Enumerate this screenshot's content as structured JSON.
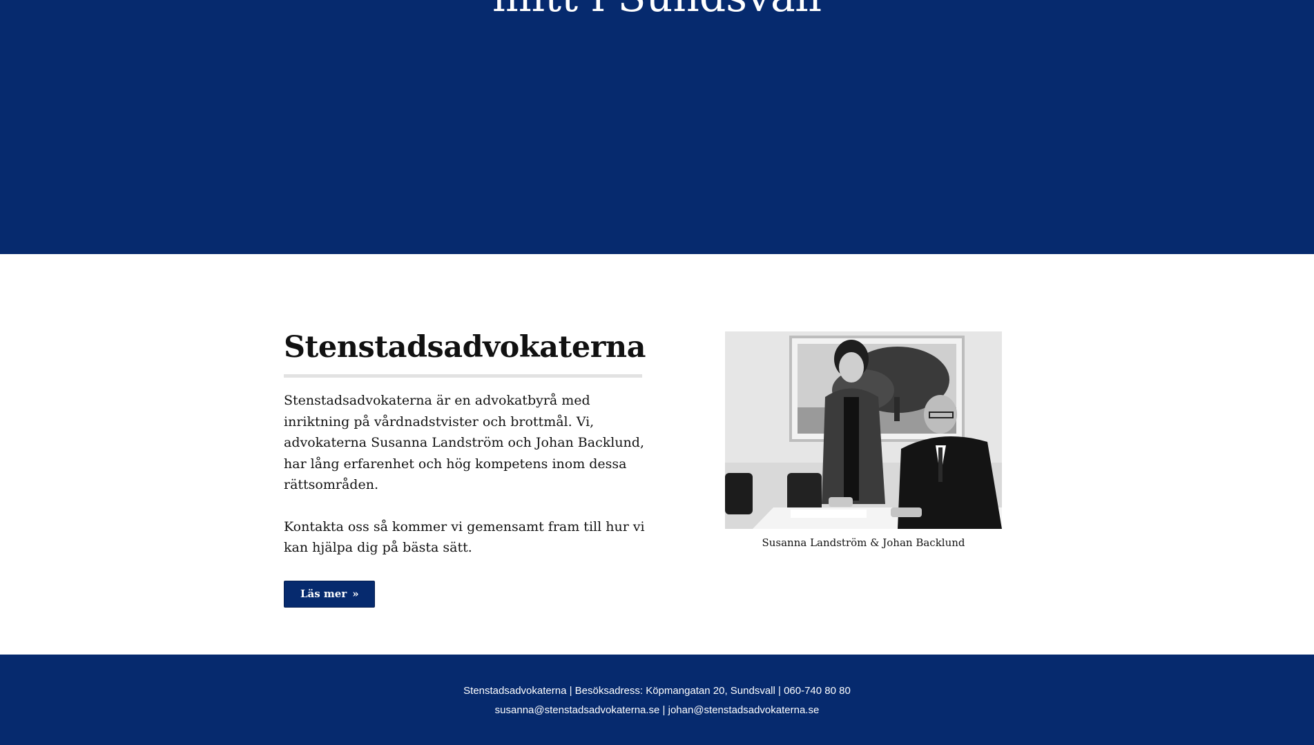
{
  "hero": {
    "title": "mitt i Sundsvall"
  },
  "about": {
    "heading": "Stenstadsadvokaterna",
    "paragraph1": "Stenstadsadvokaterna är en advokatbyrå med inriktning på vårdnadstvister och brottmål. Vi, advokaterna Susanna Landström och Johan Backlund, har lång erfarenhet och hög kompetens inom dessa rättsområden.",
    "paragraph2": "Kontakta oss så kommer vi gemensamt fram till hur vi kan hjälpa dig på bästa sätt.",
    "button_label": "Läs mer",
    "button_icon": "double-chevron-right-icon"
  },
  "photo": {
    "caption": "Susanna Landström & Johan Backlund"
  },
  "footer": {
    "line1": "Stenstadsadvokaterna | Besöksadress: Köpmangatan 20, Sundsvall | 060-740 80 80",
    "line2": "susanna@stenstadsadvokaterna.se | johan@stenstadsadvokaterna.se"
  },
  "colors": {
    "brand_navy": "#062a6e",
    "rule_gray": "#e2e2e2",
    "text_dark": "#111111"
  }
}
